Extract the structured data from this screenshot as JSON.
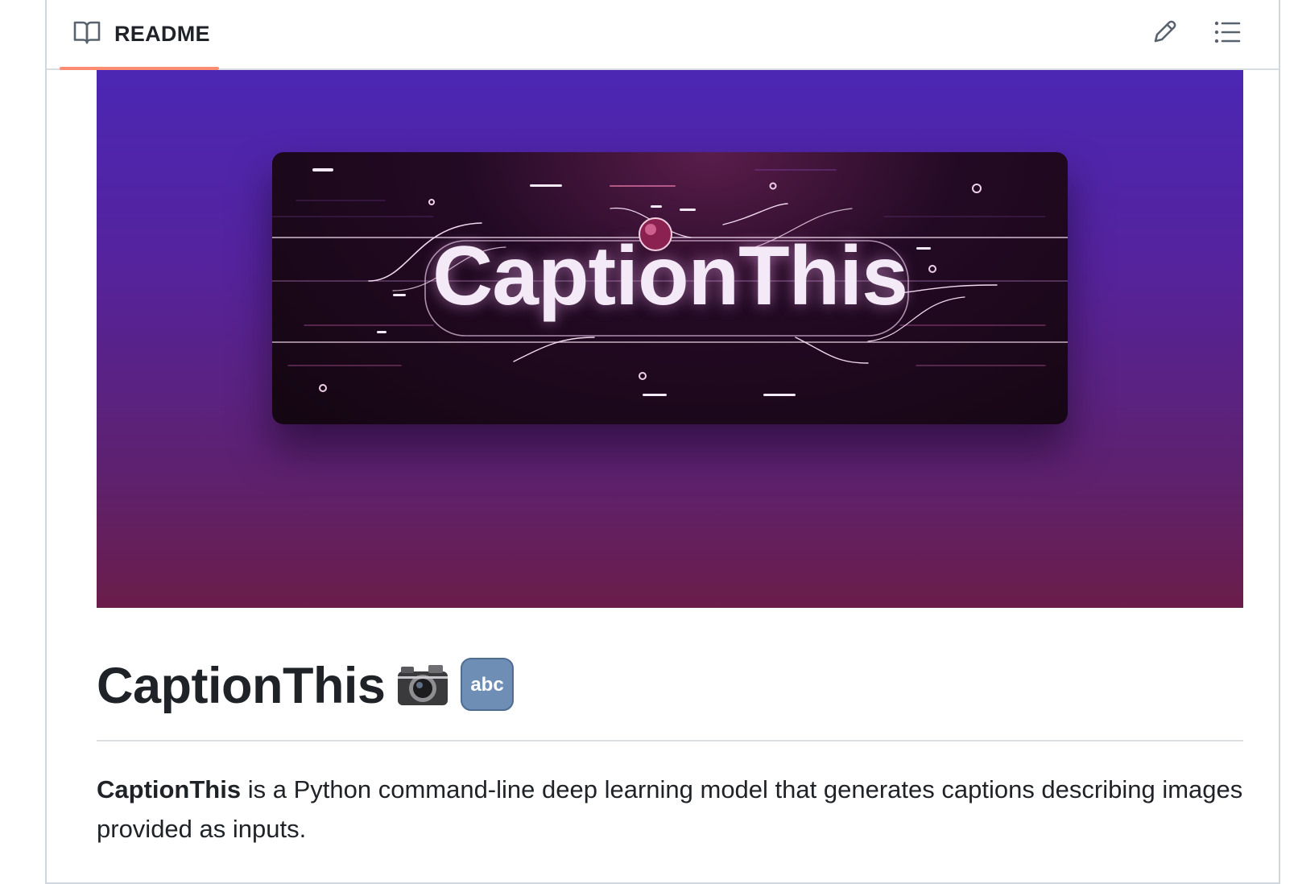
{
  "tab": {
    "label": "README",
    "accent_color": "#fd8c73"
  },
  "toolbar": {
    "edit_icon": "pencil-icon",
    "toc_icon": "list-unordered-icon"
  },
  "banner": {
    "title": "CaptionThis"
  },
  "readme": {
    "heading": "CaptionThis",
    "heading_emojis": [
      "camera-icon",
      "abc-icon"
    ],
    "paragraph_bold": "CaptionThis",
    "paragraph_rest": " is a Python command-line deep learning model that generates captions describing images provided as inputs."
  }
}
